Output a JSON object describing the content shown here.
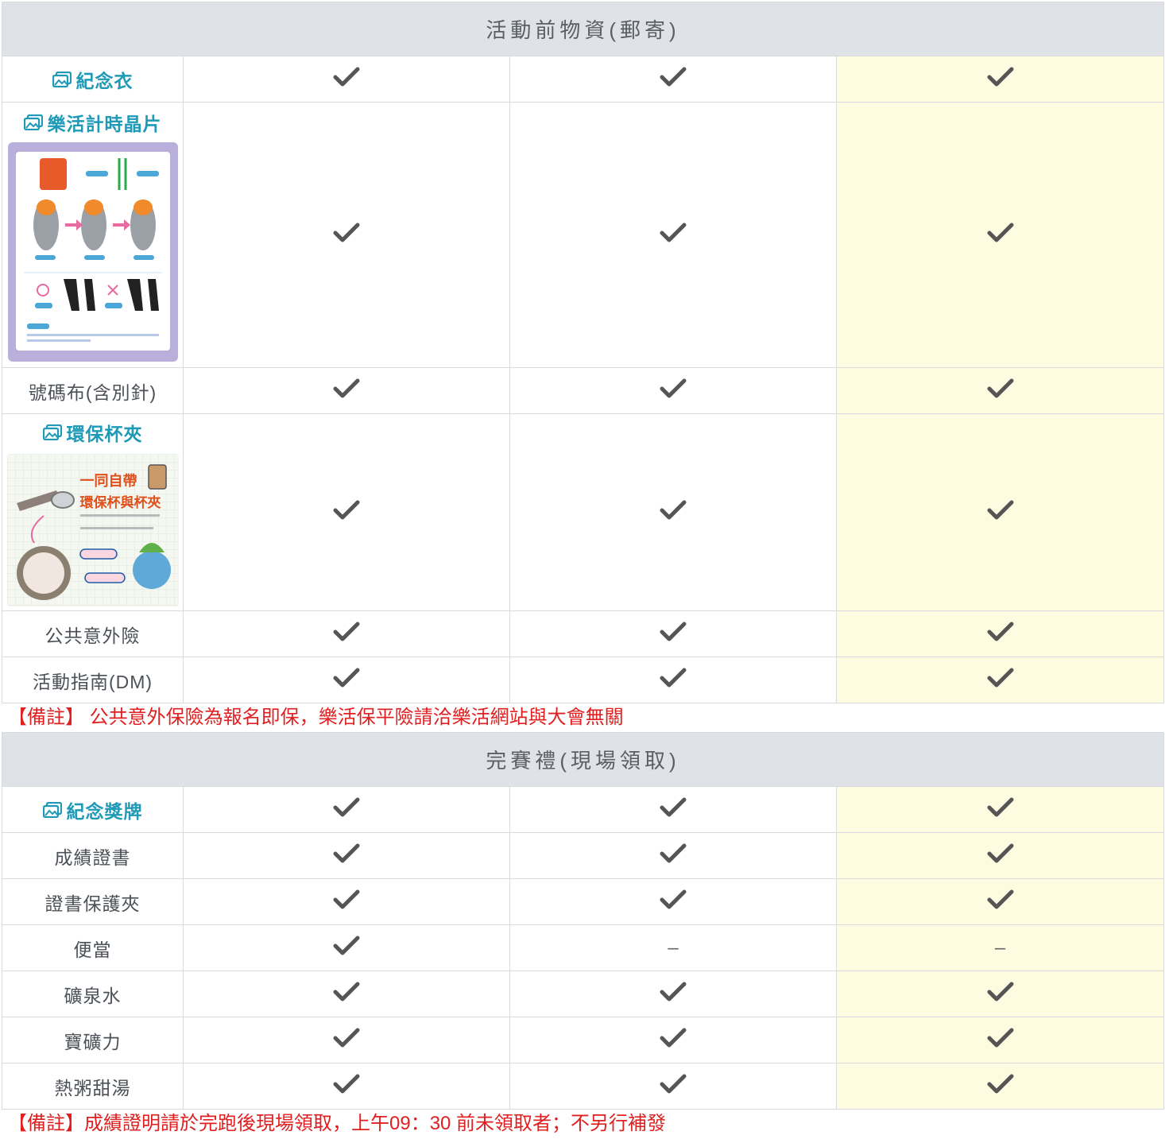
{
  "sections": [
    {
      "title": "活動前物資(郵寄)",
      "rows": [
        {
          "label": "紀念衣",
          "link": true,
          "cells": [
            "check",
            "check",
            "check"
          ]
        },
        {
          "label": "樂活計時晶片",
          "link": true,
          "cells": [
            "check",
            "check",
            "check"
          ],
          "image": "chip-instructions"
        },
        {
          "label": "號碼布(含別針)",
          "link": false,
          "cells": [
            "check",
            "check",
            "check"
          ]
        },
        {
          "label": "環保杯夾",
          "link": true,
          "cells": [
            "check",
            "check",
            "check"
          ],
          "image": "cup-clip"
        },
        {
          "label": "公共意外險",
          "link": false,
          "cells": [
            "check",
            "check",
            "check"
          ]
        },
        {
          "label": "活動指南(DM)",
          "link": false,
          "cells": [
            "check",
            "check",
            "check"
          ]
        }
      ],
      "note": "【備註】 公共意外保險為報名即保，樂活保平險請洽樂活網站與大會無關"
    },
    {
      "title": "完賽禮(現場領取)",
      "rows": [
        {
          "label": "紀念獎牌",
          "link": true,
          "cells": [
            "check",
            "check",
            "check"
          ]
        },
        {
          "label": "成績證書",
          "link": false,
          "cells": [
            "check",
            "check",
            "check"
          ]
        },
        {
          "label": "證書保護夾",
          "link": false,
          "cells": [
            "check",
            "check",
            "check"
          ]
        },
        {
          "label": "便當",
          "link": false,
          "cells": [
            "check",
            "dash",
            "dash"
          ]
        },
        {
          "label": "礦泉水",
          "link": false,
          "cells": [
            "check",
            "check",
            "check"
          ]
        },
        {
          "label": "寶礦力",
          "link": false,
          "cells": [
            "check",
            "check",
            "check"
          ]
        },
        {
          "label": "熱粥甜湯",
          "link": false,
          "cells": [
            "check",
            "check",
            "check"
          ]
        }
      ],
      "note": "【備註】成績證明請於完跑後現場領取，上午09：30 前未領取者；不另行補發"
    }
  ],
  "thumbs": {
    "cup_line1": "一同自帶",
    "cup_line2": "環保杯與杯夾"
  },
  "icons": {
    "check": "check-icon",
    "dash": "dash-icon",
    "picture": "picture-icon"
  },
  "colors": {
    "section_bg": "#dfe2e6",
    "highlight_col": "#fdfbe0",
    "link": "#1f9ab6",
    "note": "#e02020",
    "check": "#555555"
  }
}
